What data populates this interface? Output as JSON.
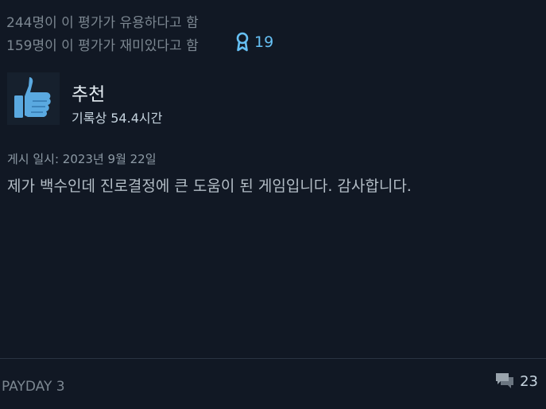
{
  "review": {
    "helpful_text": "244명이 이 평가가 유용하다고 함",
    "funny_text": "159명이 이 평가가 재미있다고 함",
    "award_count": "19",
    "verdict": "추천",
    "hours_text": "기록상 54.4시간",
    "posted_text": "게시 일시: 2023년 9월 22일",
    "body": "제가 백수인데 진로결정에 큰 도움이 된 게임입니다. 감사합니다."
  },
  "footer": {
    "game_title": "PAYDAY 3",
    "comment_count": "23"
  },
  "icons": {
    "award": "award-ribbon-icon",
    "verdict": "thumbs-up-icon",
    "comments": "comment-bubbles-icon"
  },
  "colors": {
    "background": "#111824",
    "accent": "#66c0f4",
    "thumb": "#5aa9e0",
    "muted_text": "#7c8791"
  }
}
